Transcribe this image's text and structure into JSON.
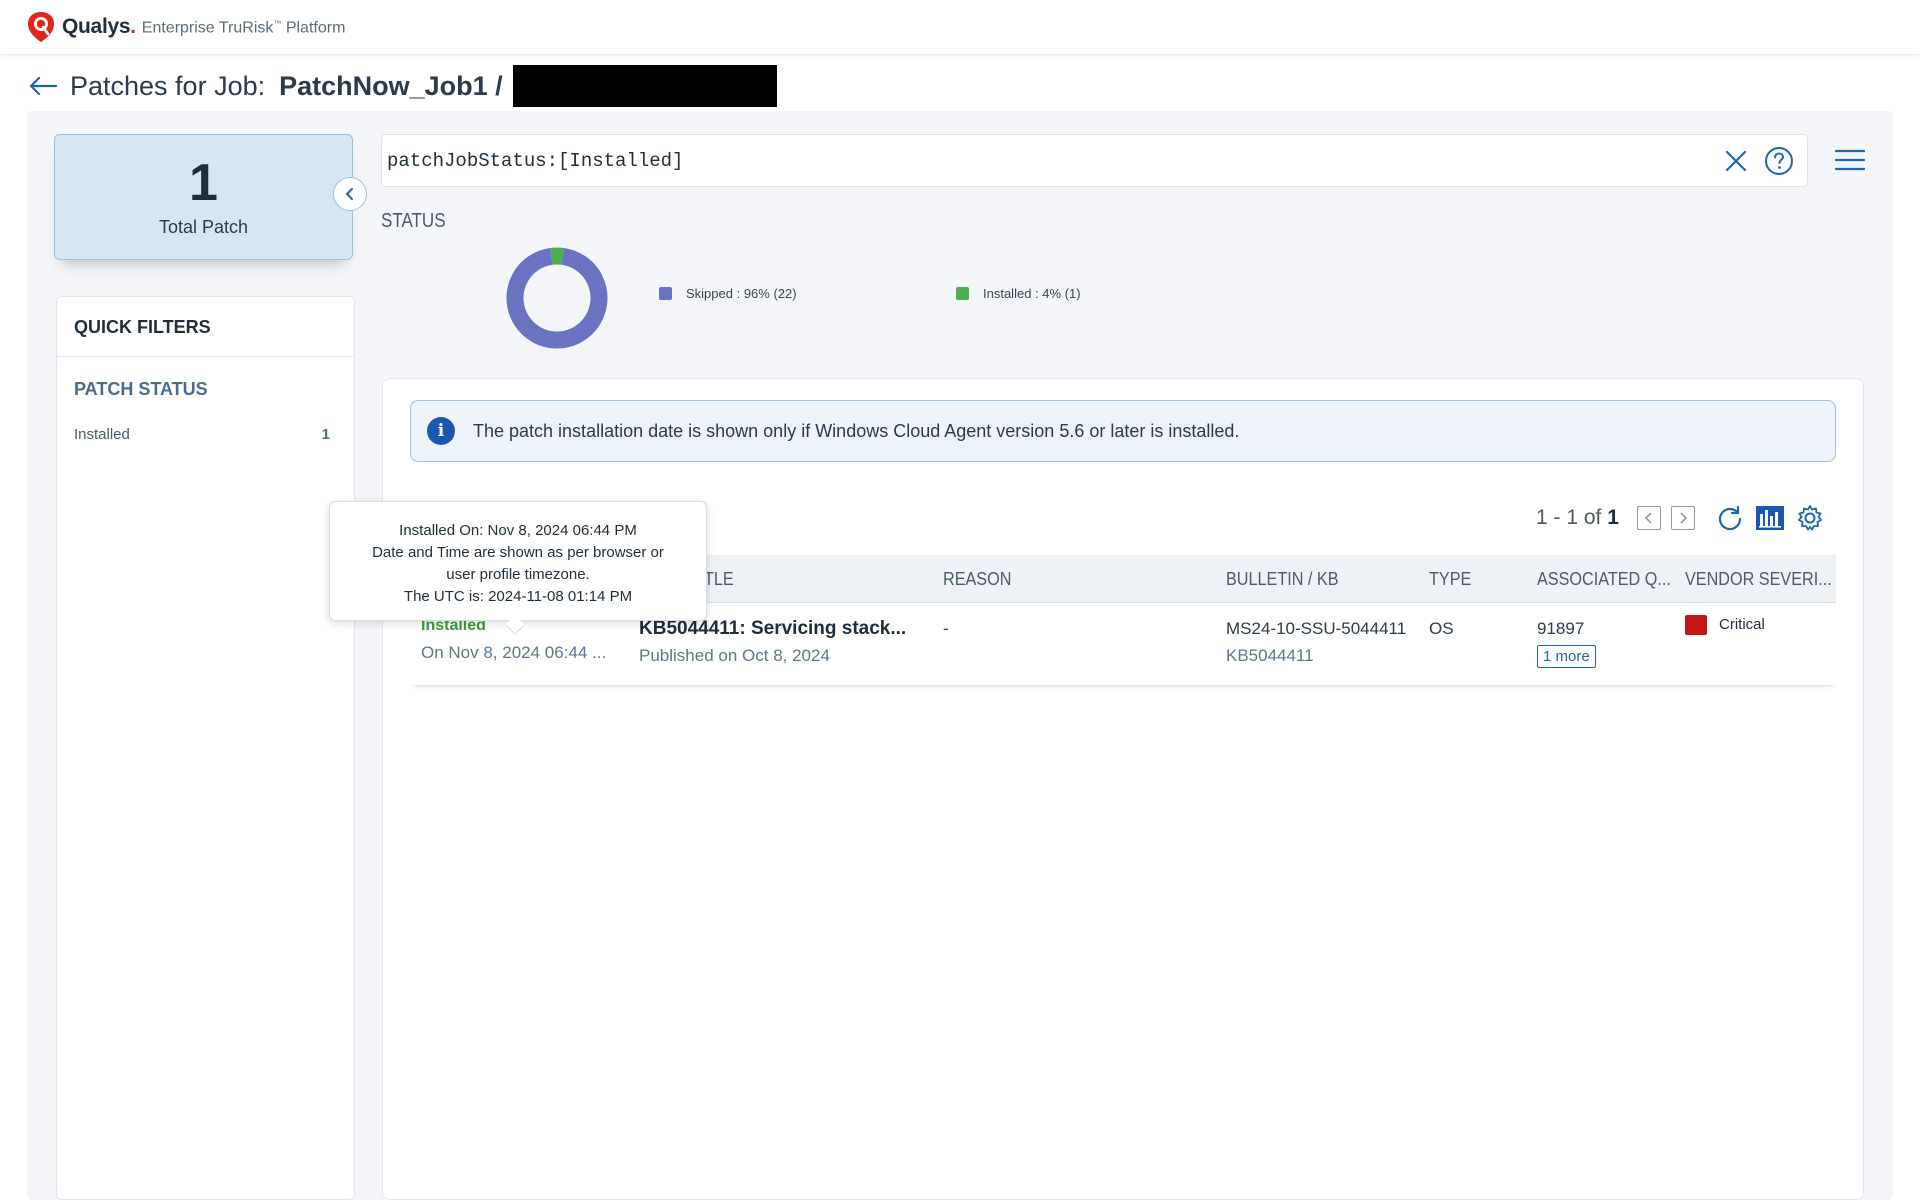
{
  "brand": {
    "name": "Qualys",
    "dot": ".",
    "product": "Enterprise TruRisk",
    "tm": "™",
    "product_suffix": "Platform"
  },
  "header": {
    "title": "Patches for Job:",
    "job_name": "PatchNow_Job1 /"
  },
  "summary": {
    "total_value": "1",
    "total_label": "Total Patch"
  },
  "quick_filters": {
    "title": "QUICK FILTERS",
    "section": "PATCH STATUS",
    "items": [
      {
        "label": "Installed",
        "count": "1"
      }
    ]
  },
  "search": {
    "value": "patchJobStatus:[Installed]"
  },
  "status_chart": {
    "label": "STATUS"
  },
  "chart_data": {
    "type": "pie",
    "title": "STATUS",
    "categories": [
      "Skipped",
      "Installed"
    ],
    "values": [
      22,
      1
    ],
    "percentages": [
      96,
      4
    ],
    "colors": [
      "#6a72c2",
      "#4caf50"
    ],
    "legend_labels": [
      "Skipped : 96% (22)",
      "Installed : 4% (1)"
    ],
    "legend": "right"
  },
  "info_banner": {
    "text": "The patch installation date is shown only if Windows Cloud Agent version 5.6 or later is installed."
  },
  "pager": {
    "range": "1 - 1 of",
    "total": "1"
  },
  "table": {
    "columns": [
      "TITLE",
      "REASON",
      "BULLETIN / KB",
      "TYPE",
      "ASSOCIATED Q...",
      "VENDOR SEVERI..."
    ],
    "title_column_visible": "TLE",
    "rows": [
      {
        "status": "Installed",
        "installed_on": "On Nov 8, 2024 06:44 ...",
        "title": "KB5044411: Servicing stack...",
        "published": "Published on Oct 8, 2024",
        "reason": "-",
        "bulletin": "MS24-10-SSU-5044411",
        "kb": "KB5044411",
        "type": "OS",
        "qid": "91897",
        "more": "1 more",
        "severity": "Critical",
        "severity_color": "#c41416"
      }
    ]
  },
  "tooltip": {
    "line1": "Installed On: Nov 8, 2024 06:44 PM",
    "line2": "Date and Time are shown as per browser or",
    "line3": "user profile timezone.",
    "line4": "The UTC is: 2024-11-08 01:14 PM"
  },
  "colors": {
    "accent": "#1a67b0",
    "installed_green": "#3c9a3c",
    "critical_red": "#c41416",
    "brand_red": "#e1251b"
  }
}
